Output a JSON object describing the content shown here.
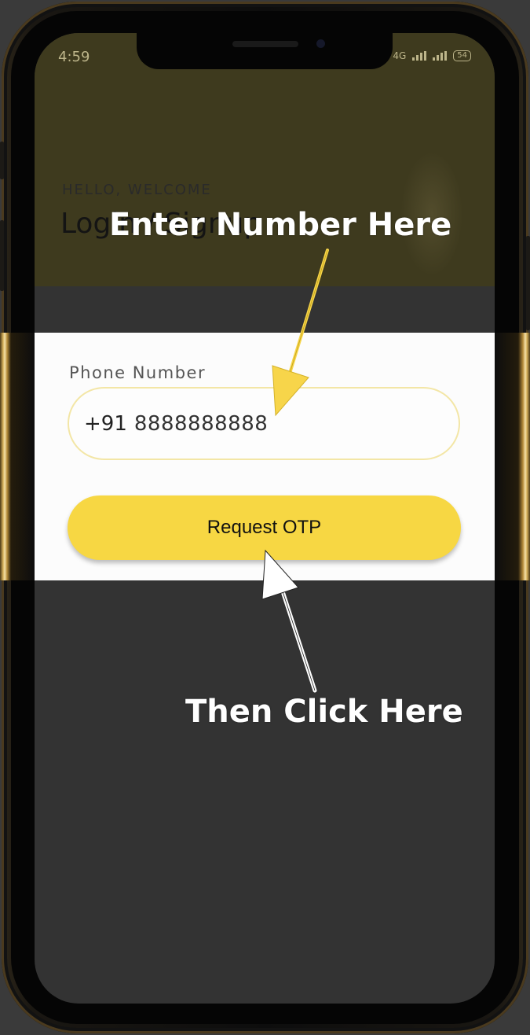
{
  "status_bar": {
    "time": "4:59",
    "network_label": "4G",
    "battery": "54"
  },
  "header": {
    "greeting": "HELLO, WELCOME",
    "title": "Login / Signup"
  },
  "form": {
    "phone_label": "Phone Number",
    "country_code": "+91",
    "phone_value": "8888888888",
    "submit_label": "Request OTP"
  },
  "annotations": {
    "top": "Enter Number Here",
    "bottom": "Then Click Here"
  },
  "colors": {
    "accent": "#f7d743",
    "field_border": "#f3e6a6",
    "overlay": "#333333",
    "arrow_top": "#f7d54a",
    "arrow_bottom": "#ffffff"
  }
}
